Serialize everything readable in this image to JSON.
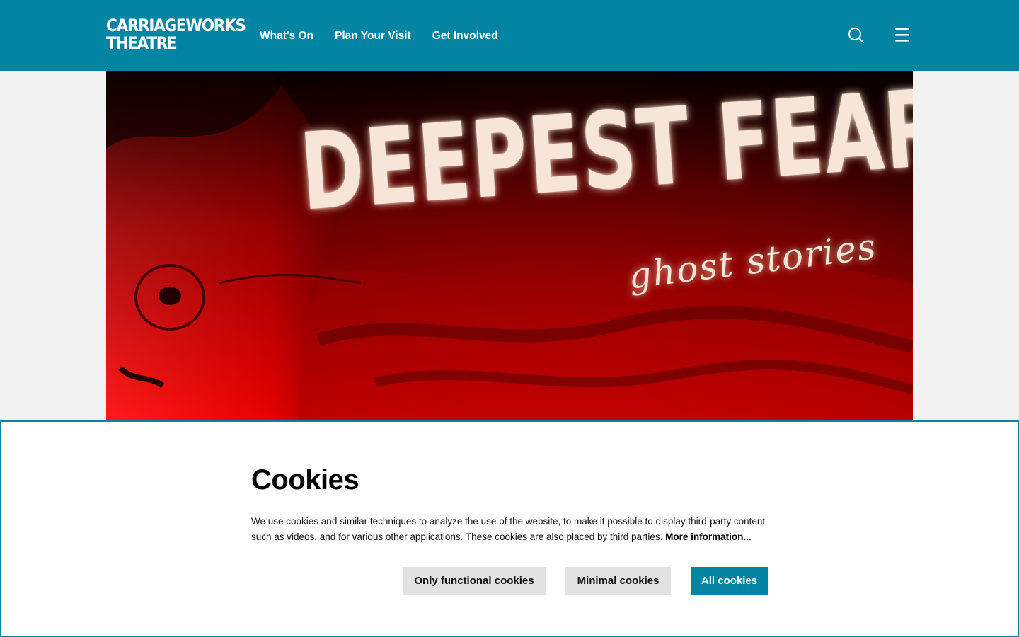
{
  "header": {
    "logo_line1": "CARRIAGEWORKS",
    "logo_line2": "THEATRE",
    "nav": [
      "What's On",
      "Plan Your Visit",
      "Get Involved"
    ],
    "icons": {
      "search": "search-icon",
      "menu": "hamburger-menu-icon"
    }
  },
  "hero": {
    "title": "DEEPEST FEARS",
    "subtitle": "ghost stories"
  },
  "cookie": {
    "title": "Cookies",
    "text": "We use cookies and similar techniques to analyze the use of the website, to make it possible to display third-party content such as videos, and for various other applications. These cookies are also placed by third parties.",
    "more_link": "More information...",
    "buttons": {
      "functional": "Only functional cookies",
      "minimal": "Minimal cookies",
      "all": "All cookies"
    }
  },
  "colors": {
    "brand": "#0284a3",
    "button_grey": "#e2e2e2",
    "hero_red": "#e80000"
  }
}
